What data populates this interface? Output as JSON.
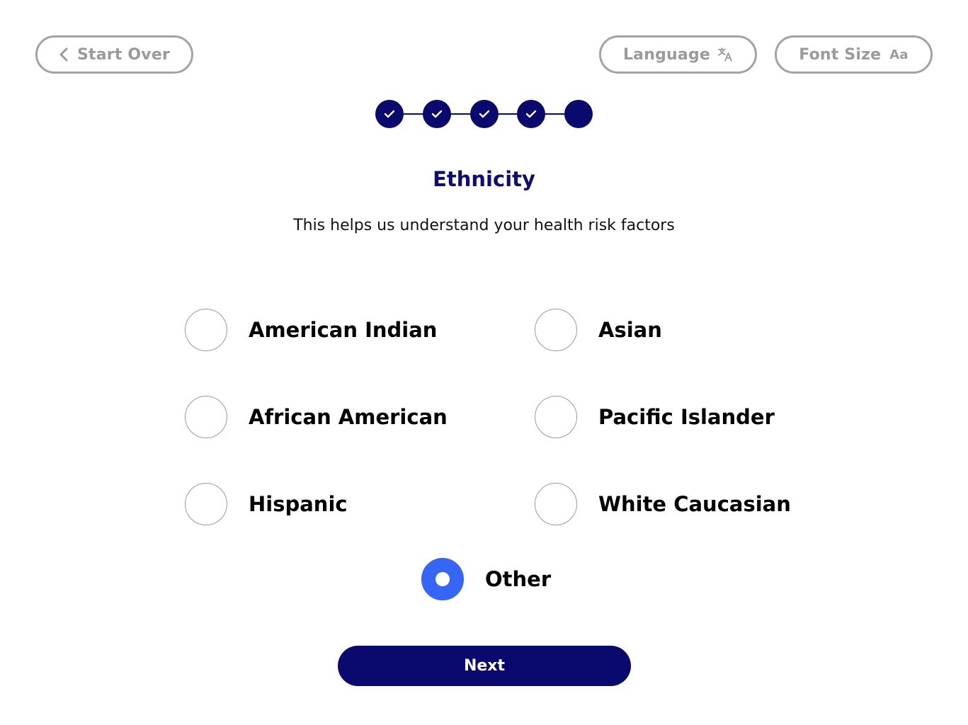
{
  "header": {
    "start_over_label": "Start Over",
    "language_label": "Language",
    "font_size_label": "Font Size",
    "font_size_icon_text": "Aa"
  },
  "progress": {
    "total_steps": 5,
    "completed_steps": 4,
    "current_step": 5
  },
  "page": {
    "title": "Ethnicity",
    "subtitle": "This helps us understand your health risk factors"
  },
  "options": [
    {
      "label": "American Indian",
      "selected": false
    },
    {
      "label": "Asian",
      "selected": false
    },
    {
      "label": "African American",
      "selected": false
    },
    {
      "label": "Pacific Islander",
      "selected": false
    },
    {
      "label": "Hispanic",
      "selected": false
    },
    {
      "label": "White Caucasian",
      "selected": false
    },
    {
      "label": "Other",
      "selected": true
    }
  ],
  "footer": {
    "next_label": "Next"
  },
  "colors": {
    "primary": "#0a0a6e",
    "selected": "#3566f5",
    "border_gray": "#a3a3a3"
  }
}
